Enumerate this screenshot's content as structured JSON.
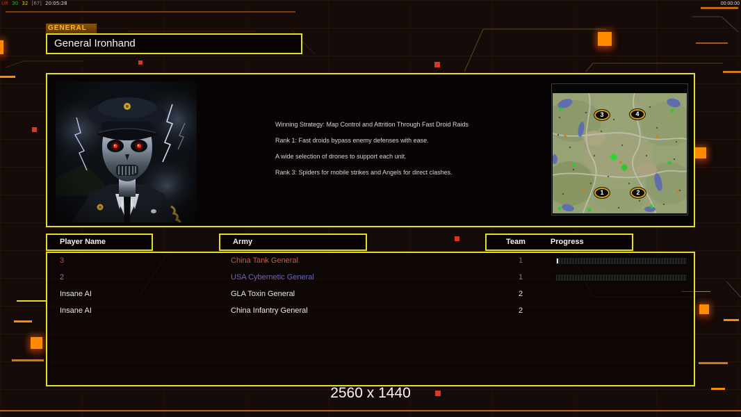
{
  "hud": {
    "debug_segments": [
      {
        "text": "UR",
        "color": "#c03828"
      },
      {
        "text": "30",
        "color": "#3cb43c"
      },
      {
        "text": "32",
        "color": "#c8c83c"
      },
      {
        "text": "[67]",
        "color": "#8a8a8a"
      },
      {
        "text": "20:05:28",
        "color": "#d8d8d8"
      }
    ],
    "timer": "00:00:00",
    "resolution_label": "2560 x 1440"
  },
  "general_panel": {
    "tab_label": "GENERAL",
    "name": "General Ironhand",
    "strategy_lines": [
      "Winning Strategy: Map Control and Attrition Through Fast Droid Raids",
      "Rank 1: Fast droids bypass enemy defenses with ease.",
      "A wide selection of drones to support each unit.",
      "Rank 3: Spiders for mobile strikes and Angels for direct clashes."
    ]
  },
  "minimap": {
    "markers": [
      {
        "label": "3"
      },
      {
        "label": "4"
      },
      {
        "label": "1"
      },
      {
        "label": "2"
      }
    ]
  },
  "table": {
    "headers": {
      "player": "Player Name",
      "army": "Army",
      "team": "Team",
      "progress": "Progress"
    },
    "players": [
      {
        "name": "3",
        "army": "China Tank General",
        "team": "1",
        "color": "#b0574a",
        "army_color": "#c1604c",
        "progress_percent": 1,
        "has_progress_bar": true
      },
      {
        "name": "2",
        "army": "USA Cybernetic General",
        "team": "1",
        "color": "#7d7dba",
        "army_color": "#6a6ac0",
        "progress_percent": 0,
        "has_progress_bar": true
      },
      {
        "name": "Insane AI",
        "army": "GLA Toxin General",
        "team": "2",
        "color": "#e8e8e8",
        "army_color": "#e8e8e8",
        "has_progress_bar": false
      },
      {
        "name": "Insane AI",
        "army": "China Infantry General",
        "team": "2",
        "color": "#e8e8e8",
        "army_color": "#e8e8e8",
        "has_progress_bar": false
      }
    ]
  },
  "colors": {
    "accent_yellow": "#e6df1a",
    "accent_orange": "#ff8c00",
    "accent_red": "#d93826",
    "tab_text": "#ffb81e"
  }
}
